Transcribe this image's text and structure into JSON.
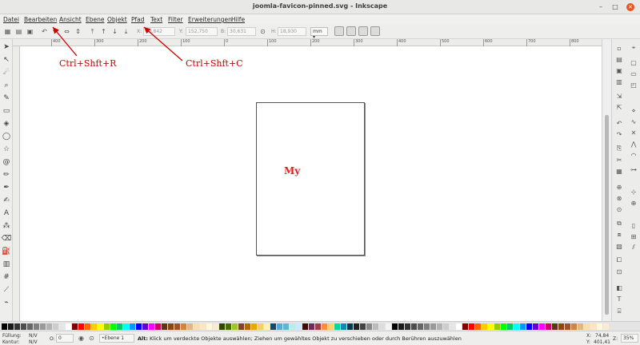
{
  "window": {
    "title": "joomla-favicon-pinned.svg - Inkscape"
  },
  "menu": [
    "Datei",
    "Bearbeiten",
    "Ansicht",
    "Ebene",
    "Objekt",
    "Pfad",
    "Text",
    "Filter",
    "Erweiterungen",
    "Hilfe"
  ],
  "controls": {
    "x_label": "X:",
    "x_value": "18,842",
    "y_label": "Y:",
    "y_value": "152,750",
    "w_label": "B:",
    "w_value": "30,631",
    "h_label": "H:",
    "h_value": "18,930",
    "unit": "mm"
  },
  "ruler": {
    "labels": [
      "400",
      "300",
      "200",
      "100",
      "0",
      "100",
      "200",
      "300",
      "400",
      "500",
      "600",
      "700",
      "800",
      "900"
    ]
  },
  "canvas": {
    "page_text": "My"
  },
  "annotations": {
    "left": "Ctrl+Shft+R",
    "right": "Ctrl+Shft+C"
  },
  "colors": {
    "annotation": "#d00000",
    "page_text": "#e02020",
    "close_button": "#e95420"
  },
  "status": {
    "fill_label": "Füllung:",
    "fill_value": "N/V",
    "stroke_label": "Kontur:",
    "stroke_value": "N/V",
    "opacity_label": "O:",
    "opacity_value": "0",
    "layer": "•Ebene 1",
    "message_bold": "Alt:",
    "message": " Klick um verdeckte Objekte auswählen; Ziehen um gewähltes Objekt zu verschieben oder durch Berühren auszuwählen",
    "x_label": "X:",
    "x_value": "74,84",
    "y_label": "Y:",
    "y_value": "401,41",
    "zoom_label": "Z:",
    "zoom_value": "35%"
  }
}
